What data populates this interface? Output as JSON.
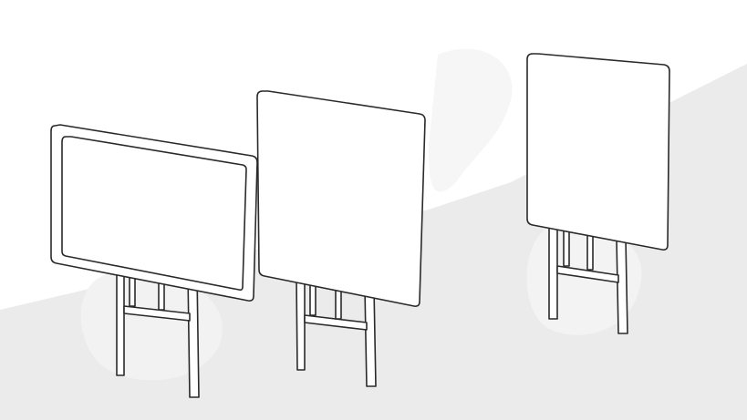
{
  "scene": {
    "description_items": [],
    "colors": {
      "background": "#ffffff",
      "floor": "#ebebeb",
      "outline": "#2a2a2a",
      "panel_fill": "#ffffff",
      "soft_shadow": "#f3f3f3"
    }
  }
}
